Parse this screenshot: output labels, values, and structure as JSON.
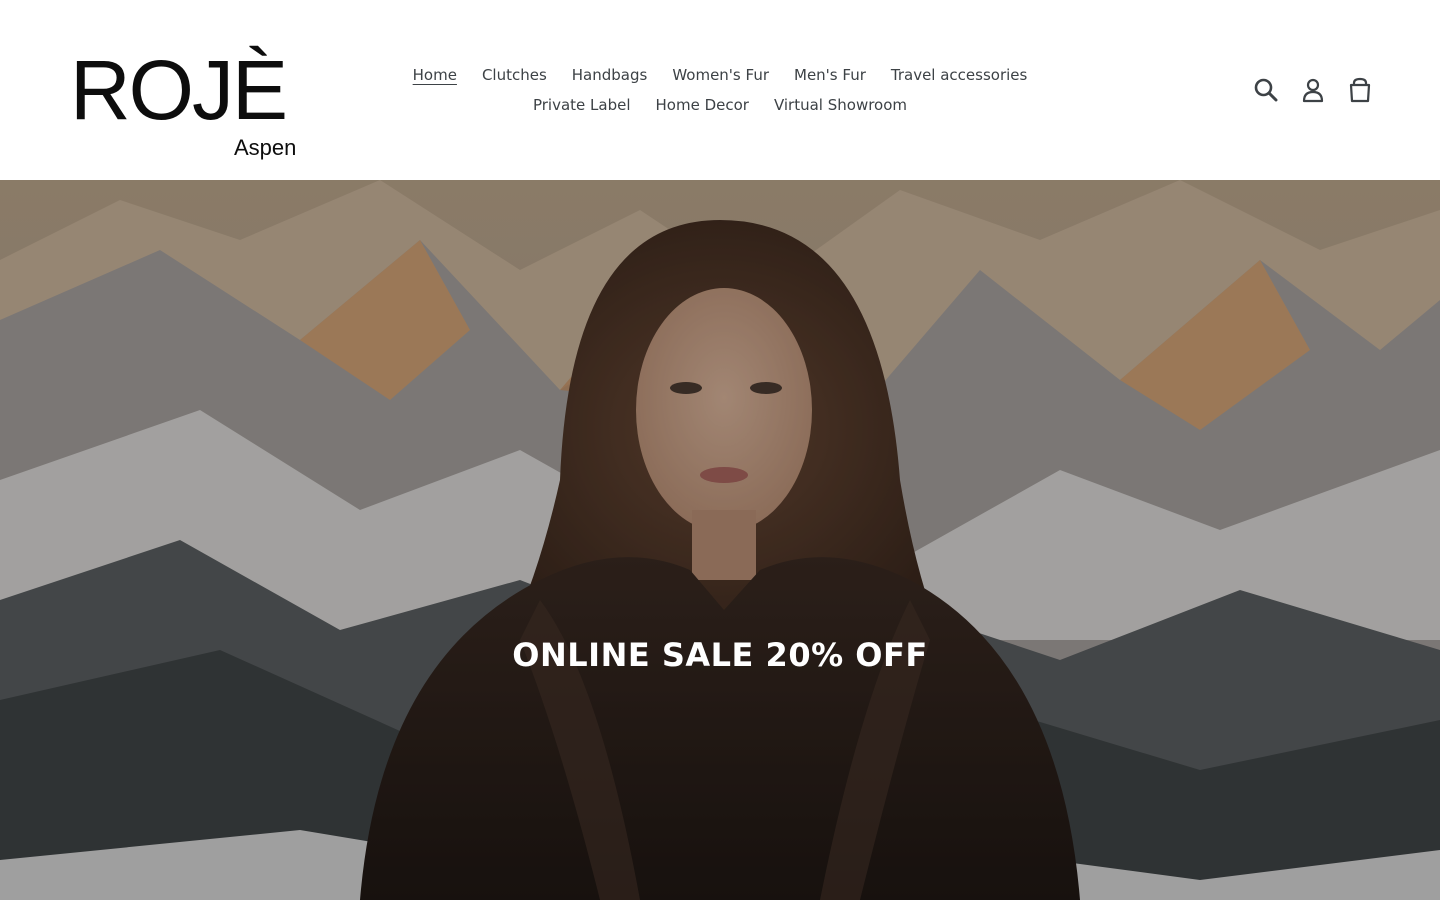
{
  "brand": {
    "name": "ROJÈ",
    "location": "Aspen"
  },
  "nav": {
    "row1": [
      {
        "label": "Home",
        "active": true
      },
      {
        "label": "Clutches",
        "active": false
      },
      {
        "label": "Handbags",
        "active": false
      },
      {
        "label": "Women's Fur",
        "active": false
      },
      {
        "label": "Men's Fur",
        "active": false
      },
      {
        "label": "Travel accessories",
        "active": false
      }
    ],
    "row2": [
      {
        "label": "Private Label",
        "active": false
      },
      {
        "label": "Home Decor",
        "active": false
      },
      {
        "label": "Virtual Showroom",
        "active": false
      }
    ]
  },
  "header_icons": [
    "search-icon",
    "account-icon",
    "cart-icon"
  ],
  "hero": {
    "heading": "ONLINE SALE 20% OFF"
  },
  "colors": {
    "nav_text": "#3d4246",
    "logo": "#0d0d0d",
    "hero_text": "#ffffff"
  }
}
